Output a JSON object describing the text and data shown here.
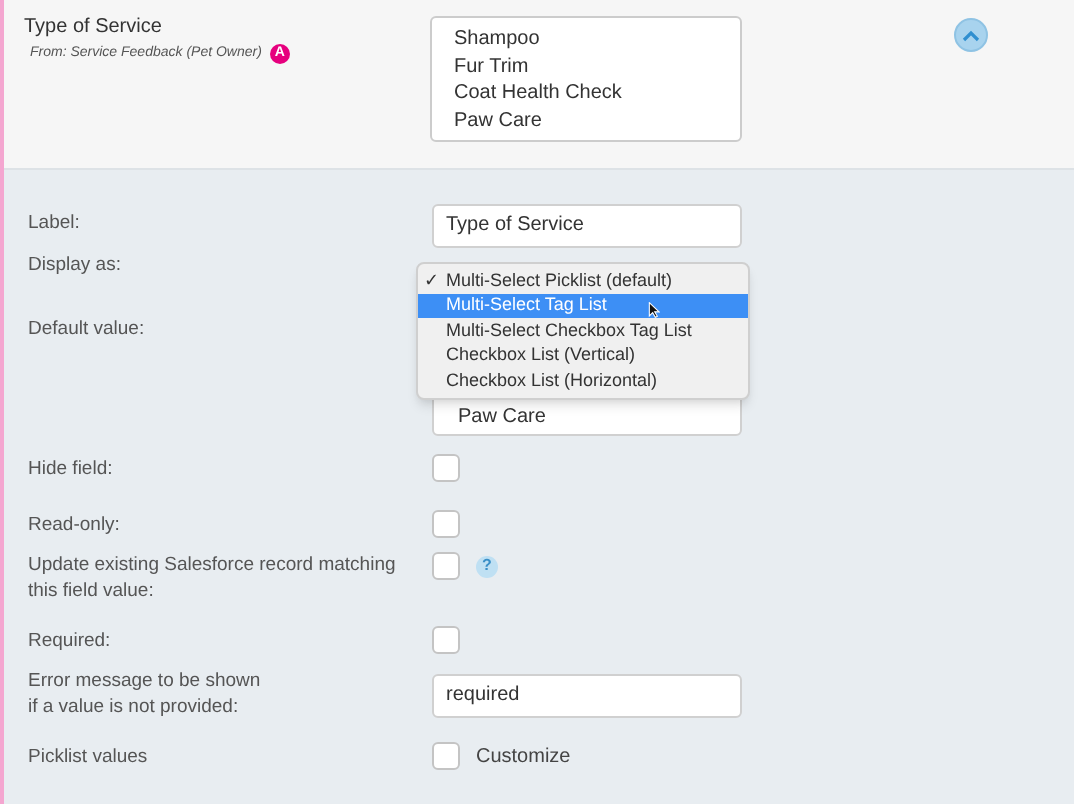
{
  "header": {
    "title": "Type of Service",
    "source": "From: Service Feedback (Pet Owner)",
    "badge": "A",
    "options": [
      "Shampoo",
      "Fur Trim",
      "Coat Health Check",
      "Paw Care"
    ],
    "expanded": true
  },
  "fields": [
    {
      "kind": "text",
      "label": "Label:",
      "value": "Type of Service"
    },
    {
      "kind": "spacer",
      "label": "Display as:"
    },
    {
      "kind": "list",
      "label": "Default value:",
      "options": [
        "Paw Care"
      ]
    },
    {
      "kind": "checkbox",
      "label": "Hide field:",
      "checked": false
    },
    {
      "kind": "checkbox",
      "label": "Read-only:",
      "checked": false
    },
    {
      "kind": "checkbox",
      "label": "Update existing Salesforce record matching this field value:",
      "checked": false,
      "help": "?"
    },
    {
      "kind": "checkbox",
      "label": "Required:",
      "checked": false
    },
    {
      "kind": "text",
      "label": "Error message to be shown\nif a value is not provided:",
      "value": "required"
    },
    {
      "kind": "checkbox",
      "label": "Picklist values",
      "checked": false,
      "caption": "Customize"
    }
  ],
  "display_menu": {
    "options": [
      {
        "label": "Multi-Select Picklist (default)",
        "checked": true,
        "selected": false
      },
      {
        "label": "Multi-Select Tag List",
        "checked": false,
        "selected": true
      },
      {
        "label": "Multi-Select Checkbox Tag List",
        "checked": false,
        "selected": false
      },
      {
        "label": "Checkbox List (Vertical)",
        "checked": false,
        "selected": false
      },
      {
        "label": "Checkbox List (Horizontal)",
        "checked": false,
        "selected": false
      }
    ],
    "check": "✓"
  }
}
